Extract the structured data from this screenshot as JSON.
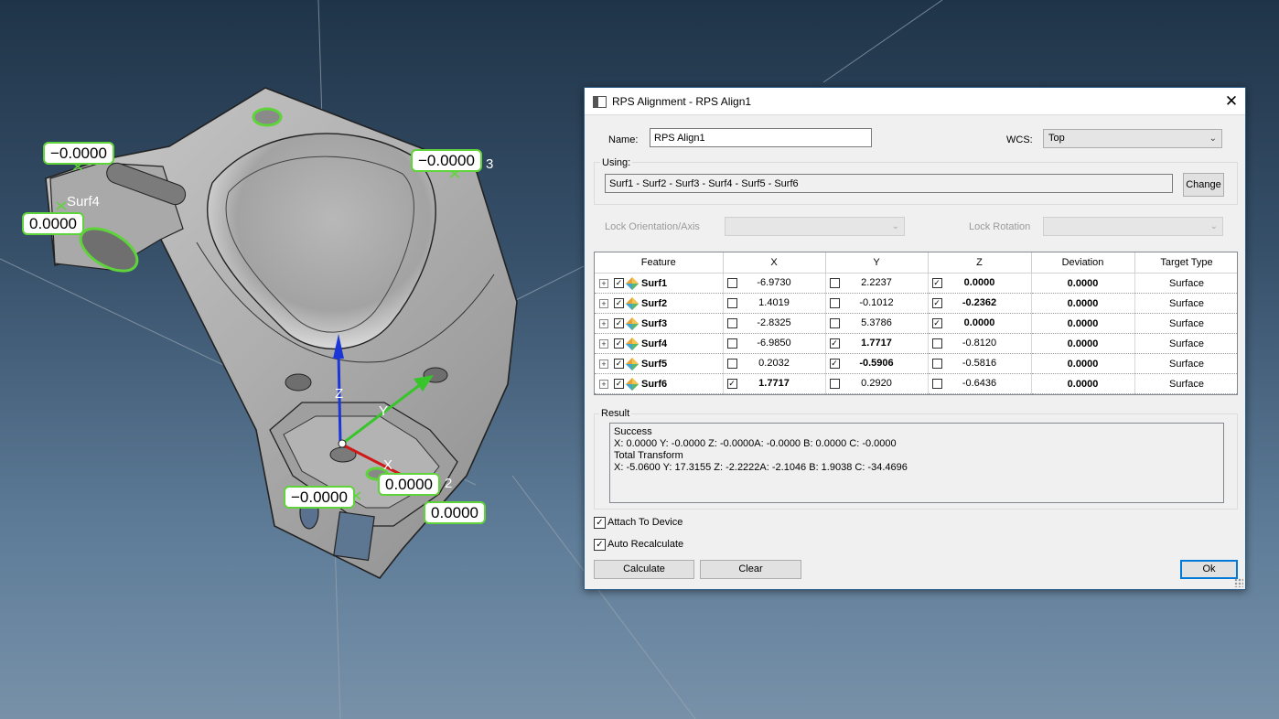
{
  "viewport": {
    "labels": [
      {
        "id": "l1",
        "text": "−0.0000"
      },
      {
        "id": "l2",
        "text": "−0.0000"
      },
      {
        "id": "l3",
        "text": "0.0000"
      },
      {
        "id": "l4",
        "text": "0.0000"
      },
      {
        "id": "l5",
        "text": "−0.0000"
      },
      {
        "id": "l6",
        "text": "0.0000"
      }
    ],
    "surf4_text": "Surf4",
    "three_text": "3",
    "two_text": "2",
    "axis_z": "Z",
    "axis_y": "Y",
    "axis_x": "X",
    "colors": {
      "highlight": "#5fd33a",
      "axis_z": "#1a35d8",
      "axis_y": "#37c52b",
      "axis_x": "#d01818"
    }
  },
  "dialog": {
    "title": "RPS Alignment - RPS Align1",
    "close_glyph": "✕",
    "name_label": "Name:",
    "name_value": "RPS Align1",
    "wcs_label": "WCS:",
    "wcs_value": "Top",
    "using_label": "Using:",
    "using_value": "Surf1 - Surf2 - Surf3 - Surf4 - Surf5 - Surf6",
    "change_label": "Change",
    "lock_orientation_label": "Lock Orientation/Axis",
    "lock_rotation_label": "Lock Rotation",
    "table": {
      "headers": [
        "Feature",
        "X",
        "Y",
        "Z",
        "Deviation",
        "Target Type"
      ],
      "rows": [
        {
          "feature": "Surf1",
          "x": "-6.9730",
          "x_checked": false,
          "x_bold": false,
          "y": "2.2237",
          "y_checked": false,
          "y_bold": false,
          "z": "0.0000",
          "z_checked": true,
          "z_bold": true,
          "deviation": "0.0000",
          "target": "Surface"
        },
        {
          "feature": "Surf2",
          "x": "1.4019",
          "x_checked": false,
          "x_bold": false,
          "y": "-0.1012",
          "y_checked": false,
          "y_bold": false,
          "z": "-0.2362",
          "z_checked": true,
          "z_bold": true,
          "deviation": "0.0000",
          "target": "Surface"
        },
        {
          "feature": "Surf3",
          "x": "-2.8325",
          "x_checked": false,
          "x_bold": false,
          "y": "5.3786",
          "y_checked": false,
          "y_bold": false,
          "z": "0.0000",
          "z_checked": true,
          "z_bold": true,
          "deviation": "0.0000",
          "target": "Surface"
        },
        {
          "feature": "Surf4",
          "x": "-6.9850",
          "x_checked": false,
          "x_bold": false,
          "y": "1.7717",
          "y_checked": true,
          "y_bold": true,
          "z": "-0.8120",
          "z_checked": false,
          "z_bold": false,
          "deviation": "0.0000",
          "target": "Surface"
        },
        {
          "feature": "Surf5",
          "x": "0.2032",
          "x_checked": false,
          "x_bold": false,
          "y": "-0.5906",
          "y_checked": true,
          "y_bold": true,
          "z": "-0.5816",
          "z_checked": false,
          "z_bold": false,
          "deviation": "0.0000",
          "target": "Surface"
        },
        {
          "feature": "Surf6",
          "x": "1.7717",
          "x_checked": true,
          "x_bold": true,
          "y": "0.2920",
          "y_checked": false,
          "y_bold": false,
          "z": "-0.6436",
          "z_checked": false,
          "z_bold": false,
          "deviation": "0.0000",
          "target": "Surface"
        }
      ]
    },
    "result_label": "Result",
    "result_lines": [
      "Success",
      "X: 0.0000 Y: -0.0000 Z: -0.0000A: -0.0000 B: 0.0000 C: -0.0000",
      "Total Transform",
      "X: -5.0600 Y: 17.3155 Z: -2.2222A: -2.1046 B: 1.9038 C: -34.4696"
    ],
    "attach_label": "Attach To Device",
    "attach_checked": true,
    "auto_label": "Auto Recalculate",
    "auto_checked": true,
    "calculate_label": "Calculate",
    "clear_label": "Clear",
    "ok_label": "Ok",
    "check_glyph": "✓",
    "expand_glyph": "+",
    "dropdown_glyph": "⌄"
  }
}
